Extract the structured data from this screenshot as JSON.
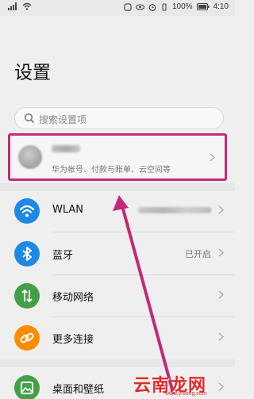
{
  "status_bar": {
    "battery_percent": "100%",
    "time": "4:10"
  },
  "title": "设置",
  "search": {
    "placeholder": "搜索设置项"
  },
  "account": {
    "subtitle": "华为帐号、付款与账单、云空间等"
  },
  "items": [
    {
      "label": "WLAN",
      "icon": "wlan-icon",
      "color": "#1e88e5",
      "value": ""
    },
    {
      "label": "蓝牙",
      "icon": "bluetooth-icon",
      "color": "#1e88e5",
      "value": "已开启"
    },
    {
      "label": "移动网络",
      "icon": "mobile-network-icon",
      "color": "#43a047",
      "value": ""
    },
    {
      "label": "更多连接",
      "icon": "more-connections-icon",
      "color": "#fb8c00",
      "value": ""
    },
    {
      "label": "桌面和壁纸",
      "icon": "desktop-wallpaper-icon",
      "color": "#43a047",
      "value": ""
    }
  ],
  "annotation": {
    "arrow_color": "#c2297a"
  },
  "watermark": {
    "text": "云南龙网",
    "url": "www.ynlong.com"
  }
}
